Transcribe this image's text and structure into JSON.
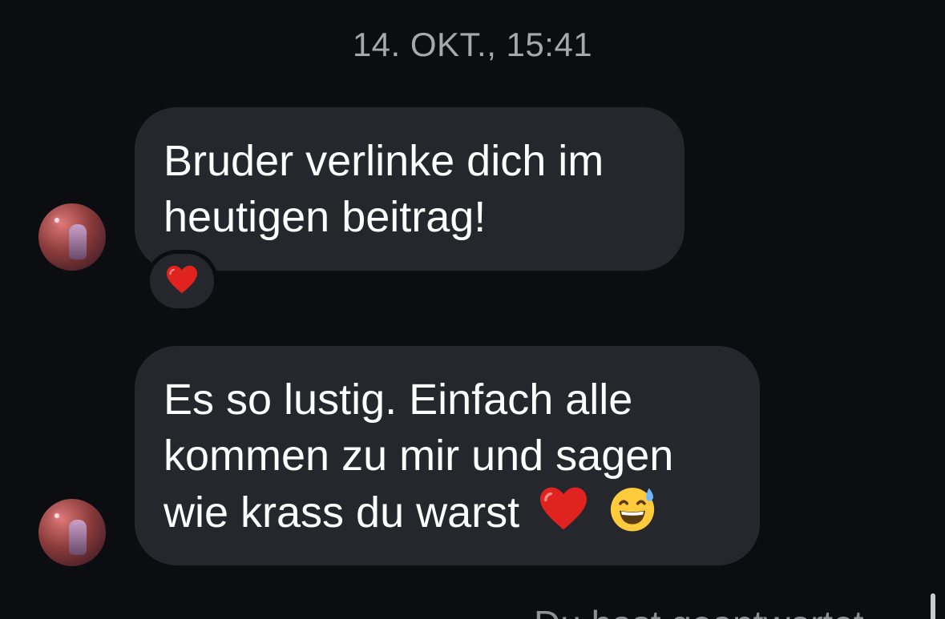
{
  "conversation": {
    "timestamp": "14. OKT., 15:41",
    "messages": [
      {
        "lines": [
          "Bruder verlinke dich im",
          "heutigen beitrag!"
        ],
        "reaction": "heart"
      },
      {
        "lines": [
          "Es so lustig. Einfach alle",
          "kommen zu mir und sagen",
          "wie krass du warst"
        ],
        "trailing_emojis": [
          "red-heart",
          "grinning-sweat"
        ]
      }
    ],
    "footer_text": "Du hast geantwortet"
  },
  "colors": {
    "background": "#0b0d11",
    "bubble": "#25272c",
    "text": "#ffffff",
    "timestamp": "#a6a8ad",
    "heart": "#e0231f"
  }
}
